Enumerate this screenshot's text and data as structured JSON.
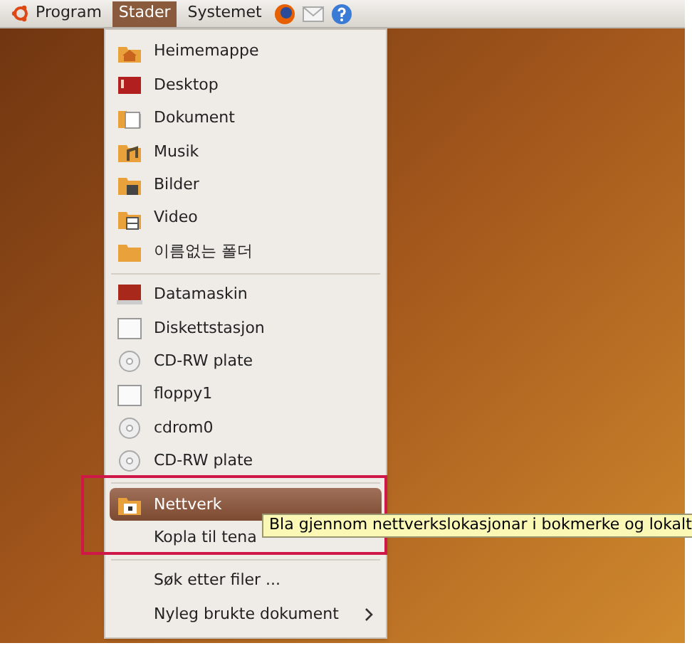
{
  "panel": {
    "menus": [
      {
        "label": "Program",
        "selected": false,
        "kind": "logo"
      },
      {
        "label": "Stader",
        "selected": true,
        "kind": "plain"
      },
      {
        "label": "Systemet",
        "selected": false,
        "kind": "plain"
      }
    ]
  },
  "menu": {
    "sections": [
      [
        {
          "label": "Heimemappe",
          "kind": "home",
          "selected": false
        },
        {
          "label": "Desktop",
          "kind": "desktop",
          "selected": false
        },
        {
          "label": "Dokument",
          "kind": "folder-doc",
          "selected": false
        },
        {
          "label": "Musik",
          "kind": "folder-music",
          "selected": false
        },
        {
          "label": "Bilder",
          "kind": "folder-pictures",
          "selected": false
        },
        {
          "label": "Video",
          "kind": "folder-video",
          "selected": false
        },
        {
          "label": "이름없는 폴더",
          "kind": "folder",
          "selected": false
        }
      ],
      [
        {
          "label": "Datamaskin",
          "kind": "computer",
          "selected": false
        },
        {
          "label": "Diskettstasjon",
          "kind": "drive",
          "selected": false
        },
        {
          "label": "CD-RW plate",
          "kind": "disc",
          "selected": false
        },
        {
          "label": "floppy1",
          "kind": "drive",
          "selected": false
        },
        {
          "label": "cdrom0",
          "kind": "disc",
          "selected": false
        },
        {
          "label": "CD-RW plate",
          "kind": "disc",
          "selected": false
        }
      ],
      [
        {
          "label": "Nettverk",
          "kind": "network",
          "selected": true
        },
        {
          "label": "Kopla til tena",
          "kind": "text",
          "selected": false
        }
      ],
      [
        {
          "label": "Søk etter filer ...",
          "kind": "text",
          "selected": false
        },
        {
          "label": "Nyleg brukte dokument",
          "kind": "submenu",
          "selected": false
        }
      ]
    ]
  },
  "tooltip": "Bla gjennom nettverkslokasjonar i bokmerke og lokalt"
}
